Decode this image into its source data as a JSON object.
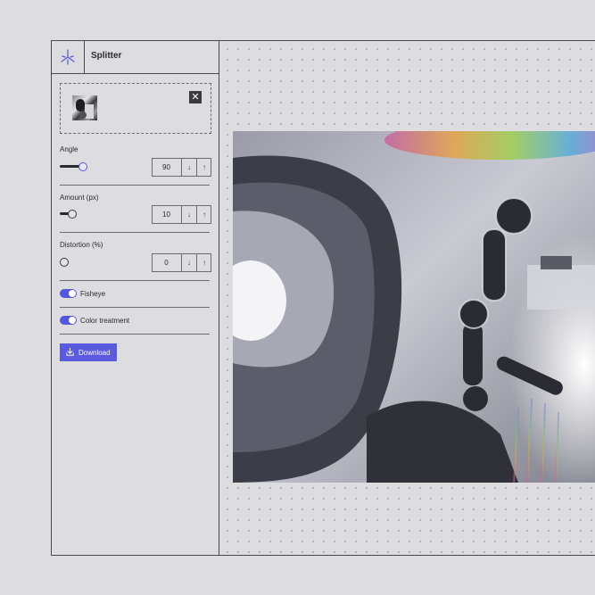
{
  "app": {
    "title": "Splitter",
    "logo_icon": "splitter-logo-icon"
  },
  "upload": {
    "thumbnail_icon": "image-thumbnail",
    "remove_label": "✕"
  },
  "controls": [
    {
      "label": "Angle",
      "value": "90",
      "slider_fraction": 0.6,
      "down": "↓",
      "up": "↑"
    },
    {
      "label": "Amount (px)",
      "value": "10",
      "slider_fraction": 0.3,
      "down": "↓",
      "up": "↑"
    },
    {
      "label": "Distortion (%)",
      "value": "0",
      "slider_fraction": 0.0,
      "down": "↓",
      "up": "↑"
    }
  ],
  "toggles": [
    {
      "label": "Fisheye",
      "on": true
    },
    {
      "label": "Color treatment",
      "on": true
    }
  ],
  "download": {
    "label": "Download",
    "icon": "download-icon"
  },
  "colors": {
    "accent": "#5a5ae0",
    "border": "#4a4a4e",
    "background": "#dddcdf"
  }
}
